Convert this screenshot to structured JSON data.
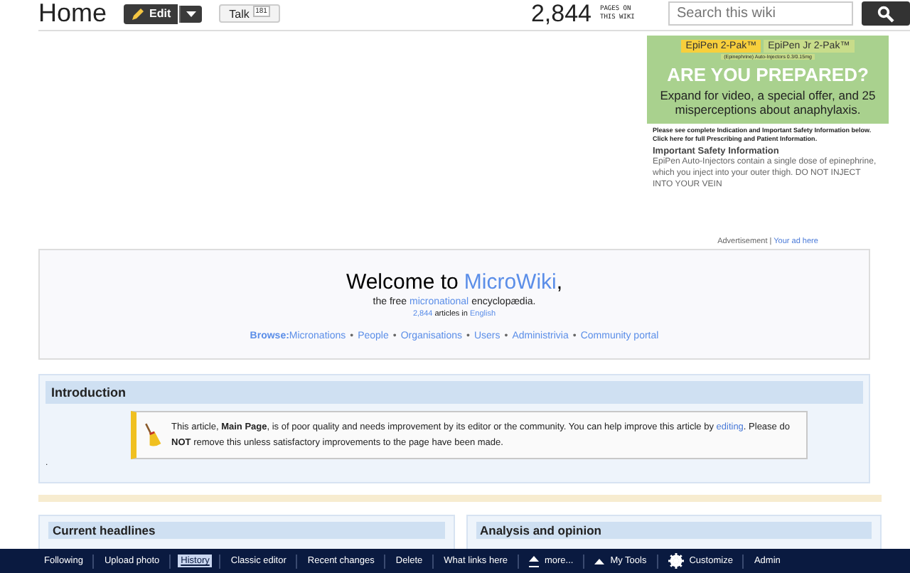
{
  "header": {
    "title": "Home",
    "edit_button": "Edit",
    "talk_button": "Talk",
    "talk_count": "181",
    "page_count": "2,844",
    "page_count_label": "PAGES ON THIS WIKI",
    "search": {
      "placeholder": "Search this wiki"
    }
  },
  "ad": {
    "logo_1": "EpiPen 2-Pak™",
    "logo_2": "EpiPen Jr 2-Pak™",
    "logo_sub": "(Epinephrine) Auto-Injectors 0.3/0.15mg",
    "headline": "ARE YOU PREPARED?",
    "body": "Expand for video, a special offer, and 25 misperceptions about anaphylaxis.",
    "notice": "Please see complete Indication and Important Safety Information below. Click here for full **Prescribing** and **Patient Information**.",
    "safety_title": "Important Safety Information",
    "safety_text": "EpiPen Auto-Injectors contain a single dose of epinephrine, which you inject into your outer thigh. DO NOT INJECT INTO YOUR VEIN",
    "caption": "Advertisement",
    "caption_sep": "|",
    "caption_link": "Your ad here"
  },
  "welcome": {
    "title_prefix": "Welcome to",
    "title_link": "MicroWiki",
    "title_suffix": ",",
    "subtitle_pre": "the free",
    "subtitle_link": "micronational",
    "subtitle_post": "encyclopædia.",
    "count_link": "2,844",
    "count_text": "articles in",
    "language_link": "English",
    "browse_label": "Browse:",
    "browse_separator": "•",
    "browse_links": [
      "Micronations",
      "People",
      "Organisations",
      "Users",
      "Administrivia",
      "Community portal"
    ]
  },
  "introduction": {
    "heading": "Introduction",
    "notice": "This article, **Main Page**, is of poor quality and needs improvement by its editor or the community. You can help improve this article by",
    "notice_link": "editing",
    "notice_end": ". Please do **NOT** remove this unless satisfactory improvements to the page have been made.",
    "trailing": "."
  },
  "panels": [
    {
      "heading": "Current headlines"
    },
    {
      "heading": "Analysis and opinion"
    }
  ],
  "toolbar": [
    {
      "label": "Following",
      "kind": "text",
      "selected": false
    },
    {
      "label": "Upload photo",
      "kind": "text",
      "selected": false
    },
    {
      "label": "History",
      "kind": "text",
      "selected": true
    },
    {
      "label": "Classic editor",
      "kind": "text",
      "selected": false
    },
    {
      "label": "Recent changes",
      "kind": "text",
      "selected": false
    },
    {
      "label": "Delete",
      "kind": "text",
      "selected": false
    },
    {
      "label": "What links here",
      "kind": "text",
      "selected": false
    },
    {
      "label": "more...",
      "kind": "more",
      "selected": false
    },
    {
      "label": "My Tools",
      "kind": "tools",
      "selected": false
    },
    {
      "label": "Customize",
      "kind": "gear",
      "selected": false
    },
    {
      "label": "Admin",
      "kind": "text",
      "selected": false
    }
  ]
}
